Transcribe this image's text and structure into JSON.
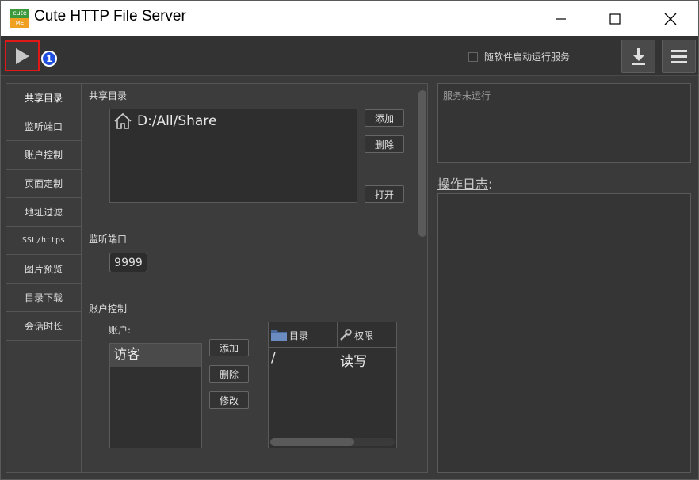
{
  "window": {
    "title": "Cute HTTP File Server",
    "logo_top": "cute",
    "logo_bottom": "ME"
  },
  "toolbar": {
    "badge": "1",
    "autostart_label": "随软件启动运行服务",
    "autostart_checked": false
  },
  "nav": {
    "items": [
      {
        "label": "共享目录"
      },
      {
        "label": "监听端口"
      },
      {
        "label": "账户控制"
      },
      {
        "label": "页面定制"
      },
      {
        "label": "地址过滤"
      },
      {
        "label": "SSL/https"
      },
      {
        "label": "图片预览"
      },
      {
        "label": "目录下载"
      },
      {
        "label": "会话时长"
      }
    ]
  },
  "share": {
    "title": "共享目录",
    "dirs": [
      "D:/All/Share"
    ],
    "add_label": "添加",
    "delete_label": "删除",
    "open_label": "打开"
  },
  "port": {
    "title": "监听端口",
    "value": "9999"
  },
  "accounts": {
    "title": "账户控制",
    "list_label": "账户:",
    "items": [
      "访客"
    ],
    "add_label": "添加",
    "delete_label": "删除",
    "edit_label": "修改",
    "table": {
      "headers": [
        "目录",
        "权限"
      ],
      "rows": [
        [
          "/",
          "读写"
        ]
      ]
    }
  },
  "status": {
    "text": "服务未运行"
  },
  "log": {
    "label_main": "操作日志",
    "label_suffix": ":"
  },
  "colors": {
    "highlight_border": "#e01818",
    "badge": "#1f4fe0",
    "background": "#3a3a3a"
  }
}
